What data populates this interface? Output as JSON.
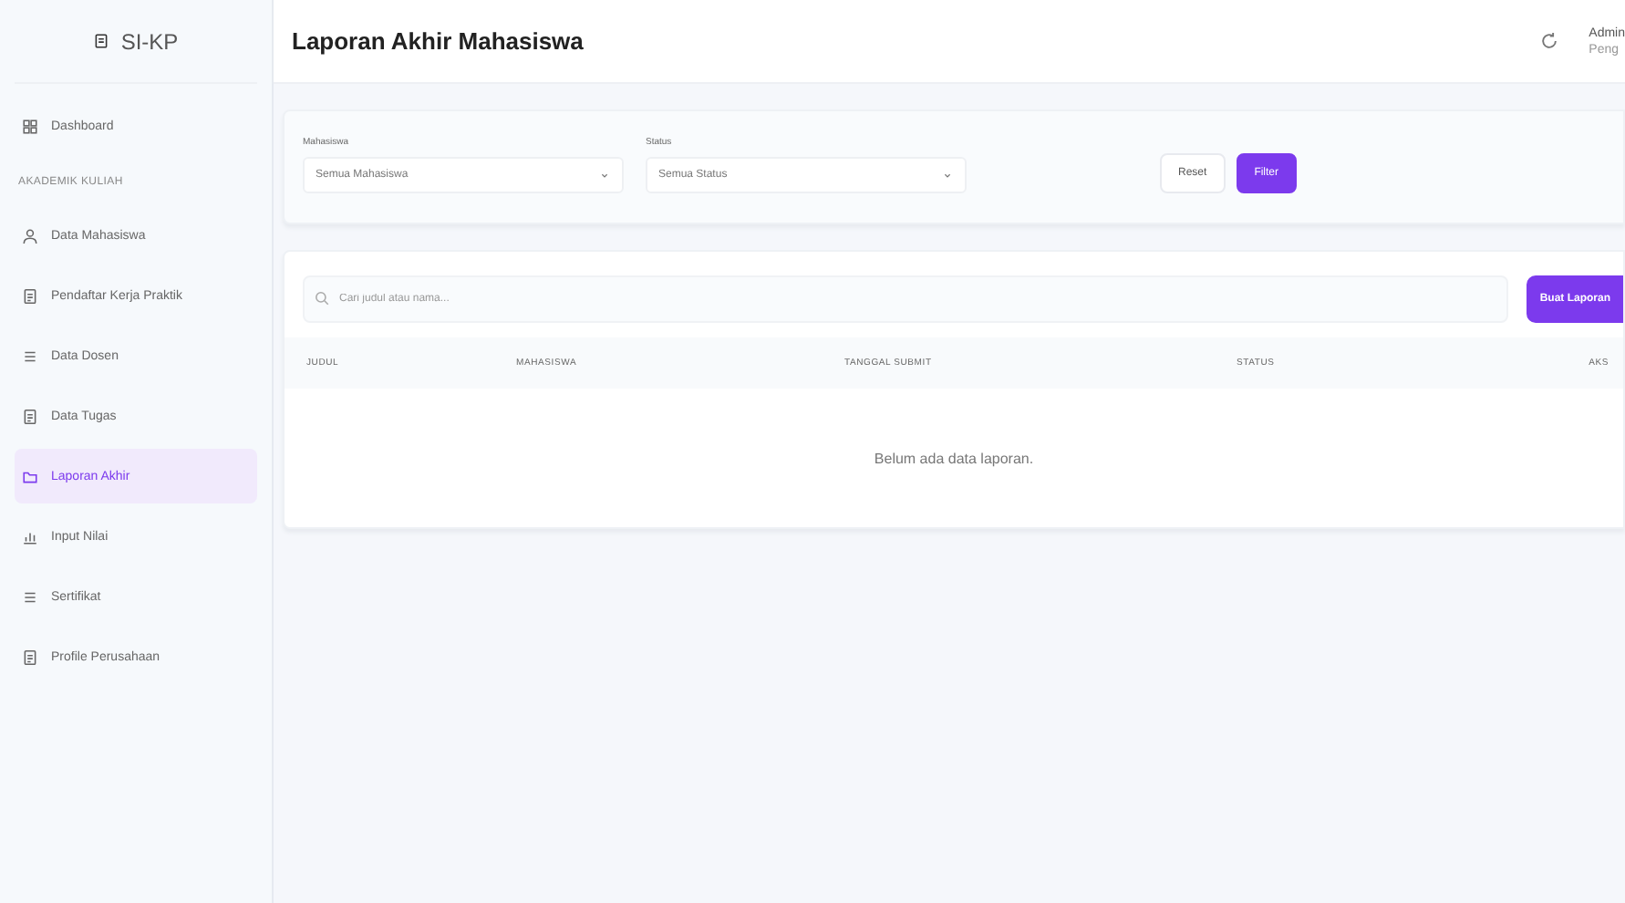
{
  "sidebar": {
    "logo": "SI-KP",
    "sections": [
      {
        "items": [
          {
            "label": "Dashboard",
            "selected": false
          }
        ]
      },
      {
        "heading": "AKADEMIK KULIAH",
        "items": [
          {
            "label": "Data Mahasiswa",
            "selected": false
          },
          {
            "label": "Pendaftar Kerja Praktik",
            "selected": false
          },
          {
            "label": "Data Dosen",
            "selected": false
          },
          {
            "label": "Data Tugas",
            "selected": false
          },
          {
            "label": "Laporan Akhir",
            "selected": true
          },
          {
            "label": "Input Nilai",
            "selected": false
          },
          {
            "label": "Sertifikat",
            "selected": false
          },
          {
            "label": "Profile Perusahaan",
            "selected": false
          }
        ]
      }
    ]
  },
  "header": {
    "title": "Laporan Akhir Mahasiswa",
    "user": {
      "name": "Admin",
      "role": "Peng"
    }
  },
  "filters": {
    "fields": [
      {
        "label": "Mahasiswa",
        "value": "Semua Mahasiswa"
      },
      {
        "label": "Status",
        "value": "Semua Status"
      }
    ],
    "buttons": [
      {
        "label": "Reset",
        "kind": "plain"
      },
      {
        "label": "Filter",
        "kind": "primary"
      }
    ]
  },
  "table": {
    "search": {
      "placeholder": "Cari judul atau nama..."
    },
    "action": "Buat Laporan",
    "columns": [
      "JUDUL",
      "MAHASISWA",
      "TANGGAL SUBMIT",
      "STATUS",
      "AKS"
    ],
    "empty": "Belum ada data laporan."
  }
}
